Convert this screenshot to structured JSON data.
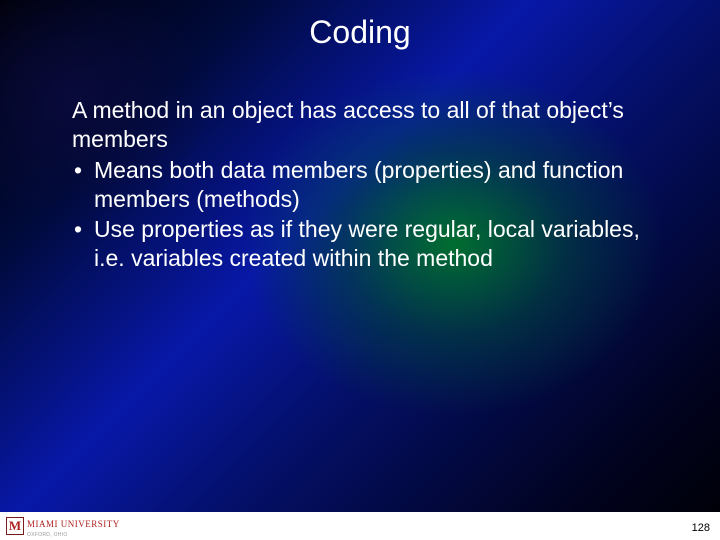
{
  "title": "Coding",
  "intro": "A method in an object has access to all of that object’s members",
  "bullets": [
    "Means both data members (properties) and function members (methods)",
    "Use properties as if they were regular, local variables, i.e. variables created within the method"
  ],
  "logo": {
    "mark": "M",
    "text": "MIAMI UNIVERSITY",
    "sub": "OXFORD, OHIO"
  },
  "page_number": "128"
}
